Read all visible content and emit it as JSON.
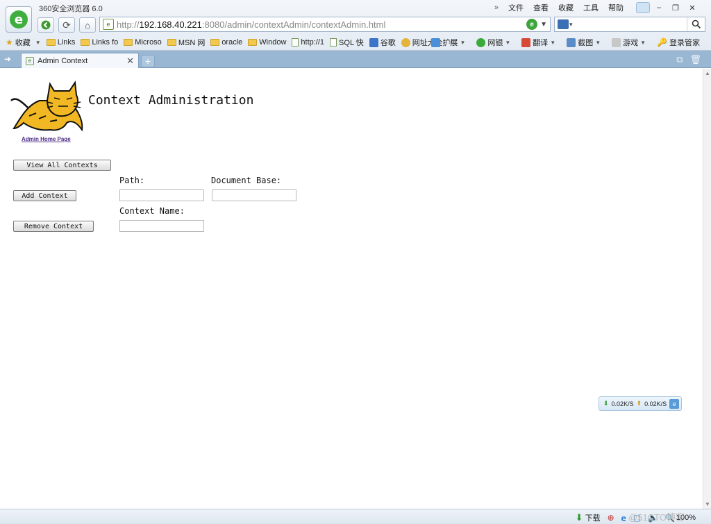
{
  "browser": {
    "title": "360安全浏览器 6.0",
    "menu": [
      "文件",
      "查看",
      "收藏",
      "工具",
      "帮助"
    ],
    "url_proto": "http://",
    "url_host": "192.168.40.221",
    "url_rest": ":8080/admin/contextAdmin/contextAdmin.html",
    "search_value": ""
  },
  "favorites": {
    "items": [
      {
        "label": "收藏",
        "icon": "star-icon"
      },
      {
        "label": "Links",
        "icon": "folder-icon"
      },
      {
        "label": "Links fo",
        "icon": "folder-icon"
      },
      {
        "label": "Microso",
        "icon": "folder-icon"
      },
      {
        "label": "MSN 网",
        "icon": "folder-icon"
      },
      {
        "label": "oracle",
        "icon": "folder-icon"
      },
      {
        "label": "Window",
        "icon": "folder-icon"
      },
      {
        "label": "http://1",
        "icon": "page-icon"
      },
      {
        "label": "SQL 快",
        "icon": "page-icon"
      },
      {
        "label": "谷歌",
        "icon": "google-icon"
      },
      {
        "label": "网址大全",
        "icon": "site-icon"
      }
    ],
    "right": [
      "扩展",
      "网银",
      "翻译",
      "截图",
      "游戏",
      "登录管家"
    ]
  },
  "tabs": [
    {
      "label": "Admin Context"
    }
  ],
  "page": {
    "home_link": "Admin Home Page",
    "title": "Context Administration",
    "buttons": {
      "view_all": "View All Contexts",
      "add": "Add Context",
      "remove": "Remove Context"
    },
    "labels": {
      "path": "Path:",
      "doc_base": "Document Base:",
      "context_name": "Context Name:"
    },
    "fields": {
      "path": "",
      "doc_base": "",
      "context_name": ""
    }
  },
  "netmon": {
    "down": "0.02K/S",
    "up": "0.02K/S"
  },
  "status": {
    "download": "下载",
    "zoom": "100%",
    "watermark": "@51CTO博客"
  }
}
